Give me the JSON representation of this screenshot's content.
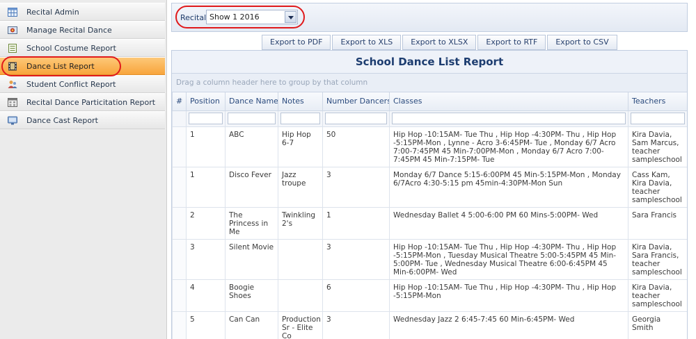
{
  "sidebar": {
    "items": [
      {
        "label": "Recital Admin",
        "icon": "table-grid-icon",
        "active": false
      },
      {
        "label": "Manage Recital Dance",
        "icon": "dancer-photo-icon",
        "active": false
      },
      {
        "label": "School Costume Report",
        "icon": "report-document-icon",
        "active": false
      },
      {
        "label": "Dance List Report",
        "icon": "film-strip-icon",
        "active": true
      },
      {
        "label": "Student Conflict Report",
        "icon": "users-conflict-icon",
        "active": false
      },
      {
        "label": "Recital Dance Particitation Report",
        "icon": "calendar-report-icon",
        "active": false
      },
      {
        "label": "Dance Cast Report",
        "icon": "monitor-cast-icon",
        "active": false
      }
    ]
  },
  "recital": {
    "label": "Recital:",
    "selected": "Show 1 2016"
  },
  "exports": [
    "Export to PDF",
    "Export to XLS",
    "Export to XLSX",
    "Export to RTF",
    "Export to CSV"
  ],
  "report": {
    "title": "School Dance List Report",
    "group_hint": "Drag a column header here to group by that column"
  },
  "columns": [
    "#",
    "Position",
    "Dance Name",
    "Notes",
    "Number Dancers",
    "Classes",
    "Teachers"
  ],
  "rows": [
    {
      "position": "1",
      "dance": "ABC",
      "notes": "Hip Hop 6-7",
      "dancers": "50",
      "classes": "Hip Hop -10:15AM- Tue Thu , Hip Hop -4:30PM- Thu , Hip Hop -5:15PM-Mon , Lynne - Acro 3-6:45PM- Tue , Monday 6/7 Acro 7:00-7:45PM 45 Min-7:00PM-Mon , Monday 6/7 Acro 7:00-7:45PM 45 Min-7:15PM- Tue",
      "teachers": "Kira Davia, Sam Marcus, teacher sampleschool"
    },
    {
      "position": "1",
      "dance": "Disco Fever",
      "notes": "Jazz troupe",
      "dancers": "3",
      "classes": "Monday 6/7 Dance 5:15-6:00PM 45 Min-5:15PM-Mon , Monday 6/7Acro 4:30-5:15 pm 45min-4:30PM-Mon Sun",
      "teachers": "Cass Kam, Kira Davia, teacher sampleschool"
    },
    {
      "position": "2",
      "dance": "The Princess in Me",
      "notes": "Twinkling 2's",
      "dancers": "1",
      "classes": "Wednesday Ballet 4 5:00-6:00 PM 60 Mins-5:00PM- Wed",
      "teachers": "Sara Francis"
    },
    {
      "position": "3",
      "dance": "Silent Movie",
      "notes": "",
      "dancers": "3",
      "classes": "Hip Hop -10:15AM- Tue Thu , Hip Hop -4:30PM- Thu , Hip Hop -5:15PM-Mon , Tuesday Musical Theatre 5:00-5:45PM 45 Min-5:00PM- Tue , Wednesday Musical Theatre 6:00-6:45PM 45 Min-6:00PM- Wed",
      "teachers": "Kira Davia, Sara Francis, teacher sampleschool"
    },
    {
      "position": "4",
      "dance": "Boogie Shoes",
      "notes": "",
      "dancers": "6",
      "classes": "Hip Hop -10:15AM- Tue Thu , Hip Hop -4:30PM- Thu , Hip Hop -5:15PM-Mon",
      "teachers": "Kira Davia, teacher sampleschool"
    },
    {
      "position": "5",
      "dance": "Can Can",
      "notes": "Production Sr - Elite Co",
      "dancers": "3",
      "classes": "Wednesday Jazz 2 6:45-7:45 60 Min-6:45PM- Wed",
      "teachers": "Georgia Smith"
    }
  ],
  "colors": {
    "active_item": "#f8a53c",
    "highlight_ring": "#e0191b",
    "title_text": "#1d3d70"
  }
}
